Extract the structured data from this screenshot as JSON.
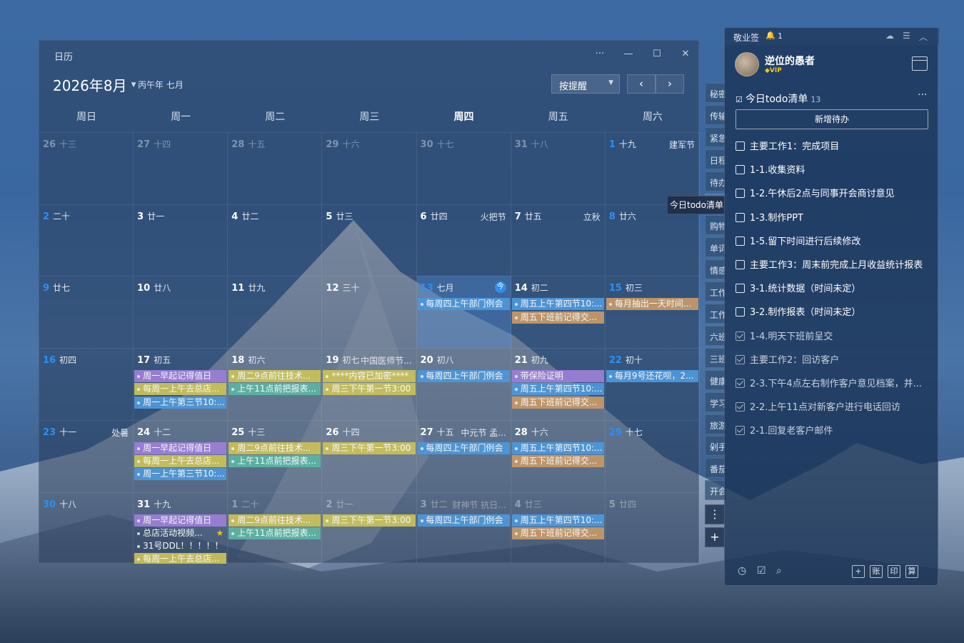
{
  "colors": {
    "purple": "#9b7fd6",
    "yellow": "#c8c05a",
    "blue": "#4e97d8",
    "orange": "#c49868",
    "green": "#5cb3a3",
    "gray": "transparent",
    "accent": "#2f8ff0"
  },
  "calendar": {
    "window_title": "日历",
    "month_label": "2026年8月",
    "lunar_month": "丙午年 七月",
    "view_mode": "按提醒",
    "weekdays": [
      "周日",
      "周一",
      "周二",
      "周三",
      "周四",
      "周五",
      "周六"
    ],
    "today_badge": "今",
    "weeks": [
      [
        {
          "d": "26",
          "l": "十三",
          "dim": true,
          "blue": true
        },
        {
          "d": "27",
          "l": "十四",
          "dim": true
        },
        {
          "d": "28",
          "l": "十五",
          "dim": true
        },
        {
          "d": "29",
          "l": "十六",
          "dim": true
        },
        {
          "d": "30",
          "l": "十七",
          "dim": true
        },
        {
          "d": "31",
          "l": "十八",
          "dim": true
        },
        {
          "d": "1",
          "l": "十九",
          "blue": true,
          "h": "建军节"
        }
      ],
      [
        {
          "d": "2",
          "l": "二十",
          "blue": true
        },
        {
          "d": "3",
          "l": "廿一"
        },
        {
          "d": "4",
          "l": "廿二"
        },
        {
          "d": "5",
          "l": "廿三"
        },
        {
          "d": "6",
          "l": "廿四",
          "h": "火把节"
        },
        {
          "d": "7",
          "l": "廿五",
          "h": "立秋"
        },
        {
          "d": "8",
          "l": "廿六",
          "blue": true
        }
      ],
      [
        {
          "d": "9",
          "l": "廿七",
          "blue": true
        },
        {
          "d": "10",
          "l": "廿八"
        },
        {
          "d": "11",
          "l": "廿九"
        },
        {
          "d": "12",
          "l": "三十"
        },
        {
          "d": "13",
          "l": "七月",
          "blue": true,
          "today": true,
          "ev": [
            {
              "t": "每周四上午部门例会",
              "c": "blue"
            }
          ]
        },
        {
          "d": "14",
          "l": "初二",
          "ev": [
            {
              "t": "周五上午第四节10:...",
              "c": "blue"
            },
            {
              "t": "周五下班前记得交...",
              "c": "orange"
            }
          ]
        },
        {
          "d": "15",
          "l": "初三",
          "blue": true,
          "ev": [
            {
              "t": "每月抽出一天时间...",
              "c": "orange"
            }
          ]
        }
      ],
      [
        {
          "d": "16",
          "l": "初四",
          "blue": true
        },
        {
          "d": "17",
          "l": "初五",
          "ev": [
            {
              "t": "周一早起记得值日",
              "c": "purple"
            },
            {
              "t": "每周一上午去总店...",
              "c": "yellow"
            },
            {
              "t": "周一上午第三节10:...",
              "c": "blue"
            }
          ]
        },
        {
          "d": "18",
          "l": "初六",
          "ev": [
            {
              "t": "周二9点前往技术...",
              "c": "yellow"
            },
            {
              "t": "上午11点前把报表...",
              "c": "green"
            }
          ]
        },
        {
          "d": "19",
          "l": "初七",
          "h": "中国医师节...",
          "ev": [
            {
              "t": "****内容已加密****",
              "c": "yellow"
            },
            {
              "t": "周三下午第一节3:00",
              "c": "yellow"
            }
          ]
        },
        {
          "d": "20",
          "l": "初八",
          "ev": [
            {
              "t": "每周四上午部门例会",
              "c": "blue"
            }
          ]
        },
        {
          "d": "21",
          "l": "初九",
          "ev": [
            {
              "t": "带保险证明",
              "c": "purple"
            },
            {
              "t": "周五上午第四节10:...",
              "c": "blue"
            },
            {
              "t": "周五下班前记得交...",
              "c": "orange"
            }
          ]
        },
        {
          "d": "22",
          "l": "初十",
          "blue": true,
          "ev": [
            {
              "t": "每月9号还花呗，2...",
              "c": "blue"
            }
          ]
        }
      ],
      [
        {
          "d": "23",
          "l": "十一",
          "blue": true,
          "h": "处暑"
        },
        {
          "d": "24",
          "l": "十二",
          "ev": [
            {
              "t": "周一早起记得值日",
              "c": "purple"
            },
            {
              "t": "每周一上午去总店...",
              "c": "yellow"
            },
            {
              "t": "周一上午第三节10:...",
              "c": "blue"
            }
          ]
        },
        {
          "d": "25",
          "l": "十三",
          "ev": [
            {
              "t": "周二9点前往技术...",
              "c": "yellow"
            },
            {
              "t": "上午11点前把报表...",
              "c": "green"
            }
          ]
        },
        {
          "d": "26",
          "l": "十四",
          "ev": [
            {
              "t": "周三下午第一节3:00",
              "c": "yellow"
            }
          ]
        },
        {
          "d": "27",
          "l": "十五",
          "h": "中元节 孟...",
          "ev": [
            {
              "t": "每周四上午部门例会",
              "c": "blue"
            }
          ]
        },
        {
          "d": "28",
          "l": "十六",
          "ev": [
            {
              "t": "周五上午第四节10:...",
              "c": "blue"
            },
            {
              "t": "周五下班前记得交...",
              "c": "orange"
            }
          ]
        },
        {
          "d": "29",
          "l": "十七",
          "blue": true
        }
      ],
      [
        {
          "d": "30",
          "l": "十八",
          "blue": true
        },
        {
          "d": "31",
          "l": "十九",
          "ev": [
            {
              "t": "周一早起记得值日",
              "c": "purple"
            },
            {
              "t": "总店活动视频...",
              "c": "gray",
              "star": true
            },
            {
              "t": "31号DDL！！！！！",
              "c": "gray"
            },
            {
              "t": "每周一上午去总店...",
              "c": "yellow"
            }
          ]
        },
        {
          "d": "1",
          "l": "二十",
          "dim": true,
          "ev": [
            {
              "t": "周二9点前往技术...",
              "c": "yellow"
            },
            {
              "t": "上午11点前把报表...",
              "c": "green"
            }
          ]
        },
        {
          "d": "2",
          "l": "廿一",
          "dim": true,
          "ev": [
            {
              "t": "周三下午第一节3:00",
              "c": "yellow"
            }
          ]
        },
        {
          "d": "3",
          "l": "廿二",
          "dim": true,
          "h": "财神节 抗日...",
          "hdim": true,
          "ev": [
            {
              "t": "每周四上午部门例会",
              "c": "blue"
            }
          ]
        },
        {
          "d": "4",
          "l": "廿三",
          "dim": true,
          "ev": [
            {
              "t": "周五上午第四节10:...",
              "c": "blue"
            },
            {
              "t": "周五下班前记得交...",
              "c": "orange"
            }
          ]
        },
        {
          "d": "5",
          "l": "廿四",
          "dim": true
        }
      ]
    ]
  },
  "side_tabs": [
    "秘密",
    "传输",
    "紧急",
    "日程",
    "待办",
    "今日",
    "购物",
    "单词",
    "情感",
    "工作",
    "工作",
    "六班",
    "三班",
    "健康",
    "学习",
    "旅游",
    "剁手",
    "番茄",
    "开会"
  ],
  "tooltip": "今日todo清单",
  "side_more": "⋮",
  "side_add": "+",
  "todo": {
    "app_name": "敬业签",
    "notif_count": "1",
    "user_name": "逆位的愚者",
    "vip": "VIP",
    "list_title": "今日todo清单",
    "list_count": "13",
    "more": "···",
    "add_label": "新增待办",
    "items": [
      {
        "t": "主要工作1：完成项目",
        "done": false
      },
      {
        "t": "1-1.收集资料",
        "done": false
      },
      {
        "t": "1-2.午休后2点与同事开会商讨意见",
        "done": false
      },
      {
        "t": "1-3.制作PPT",
        "done": false
      },
      {
        "t": "1-5.留下时间进行后续修改",
        "done": false
      },
      {
        "t": "主要工作3：周末前完成上月收益统计报表",
        "done": false
      },
      {
        "t": "3-1.统计数据（时间未定）",
        "done": false
      },
      {
        "t": "3-2.制作报表（时间未定）",
        "done": false
      },
      {
        "t": "1-4.明天下班前呈交",
        "done": true
      },
      {
        "t": "主要工作2：回访客户",
        "done": true
      },
      {
        "t": "2-3.下午4点左右制作客户意见档案，并...",
        "done": true
      },
      {
        "t": "2-2.上午11点对新客户进行电话回访",
        "done": true
      },
      {
        "t": "2-1.回复老客户邮件",
        "done": true
      }
    ],
    "footer_btns": [
      "+",
      "账",
      "印",
      "算"
    ]
  }
}
